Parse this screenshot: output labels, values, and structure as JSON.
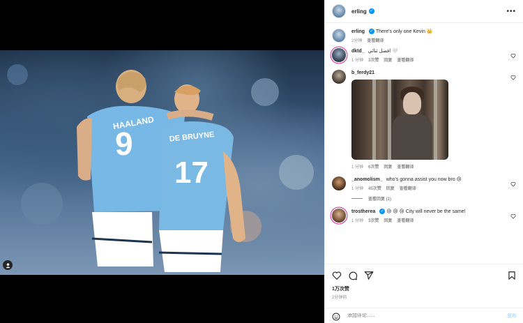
{
  "post": {
    "author": "erling",
    "caption_user": "erling",
    "caption_text": "There's only one Kevin 👑",
    "caption_time": "2分钟",
    "caption_translate": "查看翻译",
    "likes": "1万次赞",
    "time": "2分钟前"
  },
  "header": {
    "more_label": "•••"
  },
  "comments": [
    {
      "user": "dktd_",
      "text": "افضل ثنائي 🤍",
      "time": "1 分钟",
      "likes": "3次赞",
      "reply": "回复",
      "translate": "查看翻译"
    },
    {
      "user": "b_ferdy21",
      "text": "",
      "time": "1 分钟",
      "likes": "6次赞",
      "reply": "回复",
      "translate": "查看翻译"
    },
    {
      "user": "_anomolism_",
      "text": "who's gonna assist you now bro 😢",
      "time": "1 分钟",
      "likes": "45次赞",
      "reply": "回复",
      "translate": "查看翻译",
      "view_replies": "查看回复 (1)"
    },
    {
      "user": "trostherea",
      "text": "😢 😢 😢 City will never be the same!",
      "time": "1 分钟",
      "likes": "3次赞",
      "reply": "回复",
      "translate": "查看翻译"
    }
  ],
  "input": {
    "placeholder": "添加评论......",
    "post_label": "发布"
  },
  "icons": {
    "like": "heart-icon",
    "comment": "comment-icon",
    "share": "share-icon",
    "save": "bookmark-icon",
    "emoji": "emoji-icon",
    "profile": "user-icon"
  },
  "colors": {
    "verified": "#0095f6",
    "post_button": "#b2dffc"
  }
}
